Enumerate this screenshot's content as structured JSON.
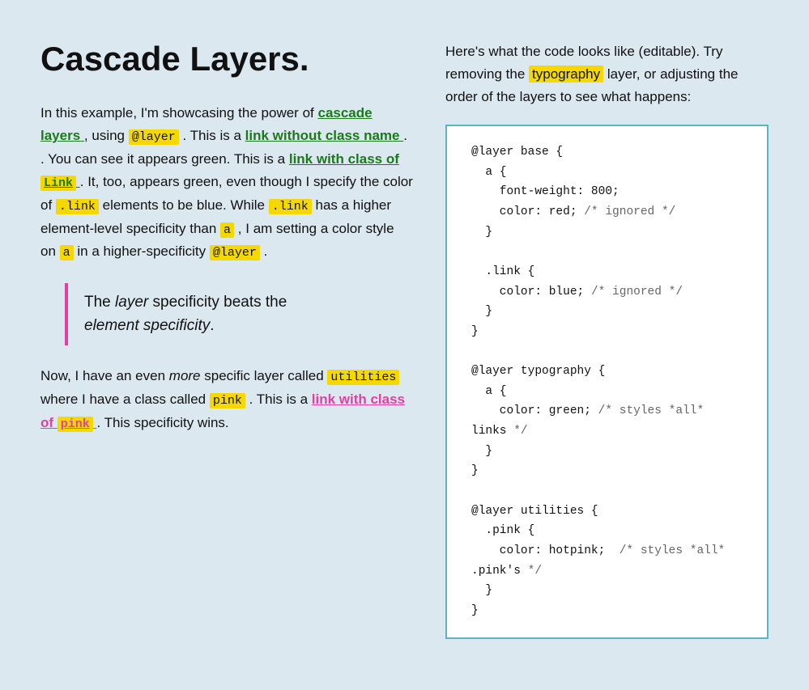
{
  "page": {
    "background": "#dce8f0",
    "title": "Cascade Layers.",
    "left": {
      "intro_1": "In this example, I'm showcasing the power of",
      "link_cascade_layers": "cascade layers",
      "intro_2": ", using",
      "at_layer_1": "@layer",
      "intro_3": ". This is a",
      "link_without_class": "link without class name",
      "intro_4": ". You can see it appears green. This is a",
      "link_with_class_label": "link with class of",
      "link_code": "Link",
      "intro_5": ". It, too, appears green, even though I specify the color of",
      "dot_link_1": ".link",
      "intro_6": "elements to be blue. While",
      "dot_link_2": ".link",
      "intro_7": "has a higher element-level specificity than",
      "a_tag_1": "a",
      "intro_8": ", I am setting a color style on",
      "a_tag_2": "a",
      "intro_9": "in a higher-specificity",
      "at_layer_2": "@layer",
      "intro_10": ".",
      "blockquote_line1": "The",
      "blockquote_italic1": "layer",
      "blockquote_line2": "specificity beats the",
      "blockquote_italic2": "element specificity",
      "blockquote_period": ".",
      "para2_1": "Now, I have an even",
      "para2_more": "more",
      "para2_2": "specific layer called",
      "utilities_code": "utilities",
      "para2_3": "where I have a class called",
      "pink_code": "pink",
      "para2_4": ". This is a",
      "link_with_class_pink_label": "link with class of",
      "pink_highlight": "pink",
      "para2_5": ". This specificity wins."
    },
    "right": {
      "intro_1": "Here's what the code looks like (editable). Try removing the",
      "typography_highlight": "typography",
      "intro_2": "layer, or adjusting the order of the layers to see what happens:",
      "code": "@layer base {\n  a {\n    font-weight: 800;\n    color: red; /* ignored */\n  }\n\n  .link {\n    color: blue; /* ignored */\n  }\n}\n\n@layer typography {\n  a {\n    color: green; /* styles *all*\nlinks */\n  }\n}\n\n@layer utilities {\n  .pink {\n    color: hotpink;  /* styles *all*\n.pink's */\n  }\n}"
    }
  }
}
